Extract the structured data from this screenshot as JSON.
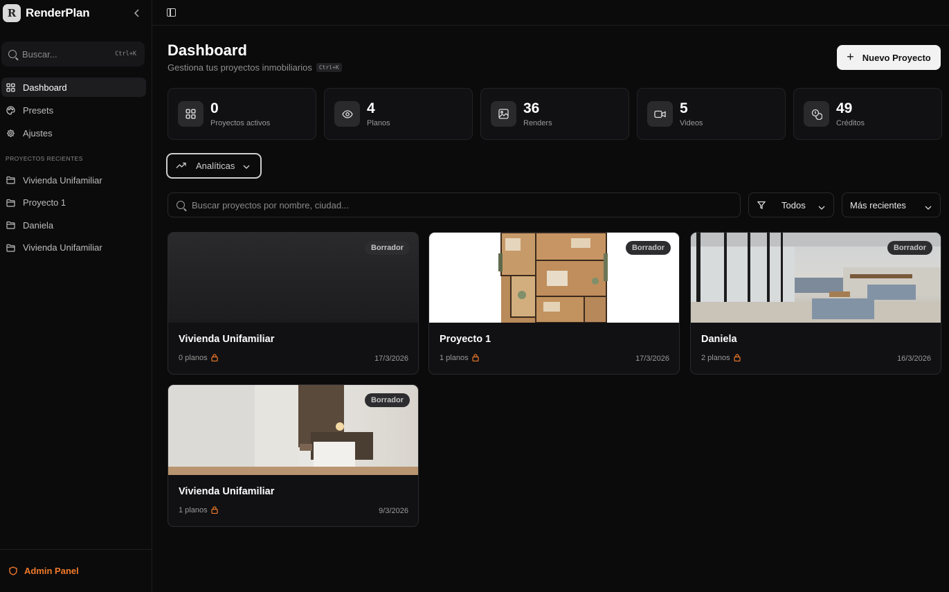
{
  "sidebar": {
    "brand": "RenderPlan",
    "logo_letter": "R",
    "search_placeholder": "Buscar...",
    "search_shortcut": "Ctrl+K",
    "nav": [
      {
        "label": "Dashboard",
        "icon": "grid-icon",
        "active": true
      },
      {
        "label": "Presets",
        "icon": "palette-icon",
        "active": false
      },
      {
        "label": "Ajustes",
        "icon": "gear-icon",
        "active": false
      }
    ],
    "recent_label": "PROYECTOS RECIENTES",
    "recent": [
      {
        "label": "Vivienda Unifamiliar",
        "icon": "folder-icon"
      },
      {
        "label": "Proyecto 1",
        "icon": "folder-icon"
      },
      {
        "label": "Daniela",
        "icon": "folder-icon"
      },
      {
        "label": "Vivienda Unifamiliar",
        "icon": "folder-icon"
      }
    ],
    "admin": "Admin Panel",
    "accent": "#f07a2a"
  },
  "header": {
    "title": "Dashboard",
    "subtitle": "Gestiona tus proyectos inmobiliarios",
    "shortcut": "Ctrl+K",
    "new_button": "Nuevo Proyecto"
  },
  "stats": [
    {
      "value": "0",
      "label": "Proyectos activos",
      "icon": "grid-icon"
    },
    {
      "value": "4",
      "label": "Planos",
      "icon": "eye-icon"
    },
    {
      "value": "36",
      "label": "Renders",
      "icon": "image-icon"
    },
    {
      "value": "5",
      "label": "Videos",
      "icon": "video-icon"
    },
    {
      "value": "49",
      "label": "Créditos",
      "icon": "coins-icon"
    }
  ],
  "analytics": {
    "label": "Analíticas"
  },
  "filters": {
    "search_placeholder": "Buscar proyectos por nombre, ciudad...",
    "status": "Todos",
    "sort": "Más recientes"
  },
  "projects": [
    {
      "title": "Vivienda Unifamiliar",
      "plans": "0 planos",
      "date": "17/3/2026",
      "badge": "Borrador",
      "thumb": "empty"
    },
    {
      "title": "Proyecto 1",
      "plans": "1 planos",
      "date": "17/3/2026",
      "badge": "Borrador",
      "thumb": "floor-plan"
    },
    {
      "title": "Daniela",
      "plans": "2 planos",
      "date": "16/3/2026",
      "badge": "Borrador",
      "thumb": "living-room"
    },
    {
      "title": "Vivienda Unifamiliar",
      "plans": "1 planos",
      "date": "9/3/2026",
      "badge": "Borrador",
      "thumb": "bedroom"
    }
  ]
}
